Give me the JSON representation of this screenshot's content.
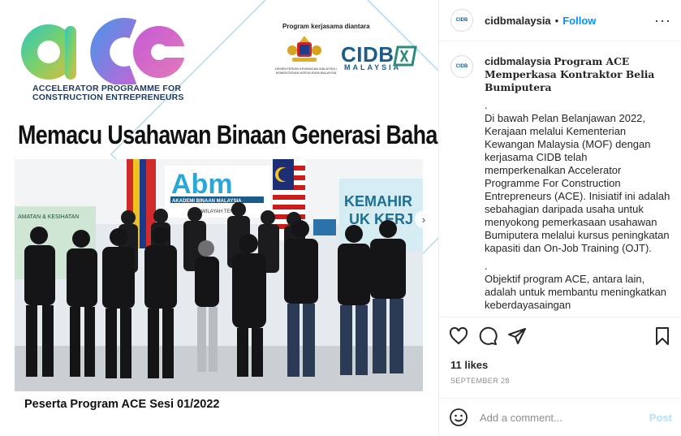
{
  "media": {
    "logo_text": "ACE",
    "logo_subtitle_line1": "ACCELERATOR PROGRAMME FOR",
    "logo_subtitle_line2": "CONSTRUCTION ENTREPRENEURS",
    "collab_label": "Program kerjasama  diantara",
    "ministry_label": "KEMENTERIAN KEWANGAN MALAYSIA / KEMENTERIAN KERJA RAYA MALAYSIA",
    "cidb_name": "CIDB",
    "cidb_country": "MALAYSIA",
    "headline": "Memacu Usahawan Binaan Generasi Baharu",
    "photo_sign_abm": "Abm",
    "photo_sign_academy": "AKADEMI BINAAN MALAYSIA",
    "photo_sign_region": "WILAYAH TENGAH",
    "photo_sign_right": "KEMAHIR",
    "photo_sign_right2": "UK KERJ",
    "photo_sign_left": "AMATAN & KESIHATAN",
    "caption": "Peserta Program ACE Sesi 01/2022",
    "next_icon": "chevron-right-icon"
  },
  "header": {
    "username": "cidbmalaysia",
    "separator": "•",
    "follow_label": "Follow",
    "more_label": "···",
    "avatar_text": "CIDB"
  },
  "caption_block": {
    "username": "cidbmalaysia",
    "title": "Program ACE Memperkasa Kontraktor Belia Bumiputera",
    "dot1": ".",
    "para1": "Di bawah Pelan Belanjawan 2022, Kerajaan melalui Kementerian Kewangan Malaysia (MOF) dengan kerjasama CIDB telah memperkenalkan Accelerator Programme For Construction Entrepreneurs (ACE). Inisiatif ini adalah sebahagian daripada usaha untuk menyokong pemerkasaan usahawan Bumiputera melalui kursus peningkatan kapasiti dan On-Job Training (OJT).",
    "dot2": ".",
    "para2": "Objektif program ACE, antara lain, adalah untuk membantu meningkatkan keberdayasaingan"
  },
  "actions": {
    "likes": "11 likes",
    "date": "SEPTEMBER 28"
  },
  "comment_box": {
    "placeholder": "Add a comment...",
    "post_label": "Post"
  },
  "colors": {
    "accent": "#0095f6",
    "post_disabled": "#b2dffc",
    "cidb_blue": "#1b5c8b"
  }
}
